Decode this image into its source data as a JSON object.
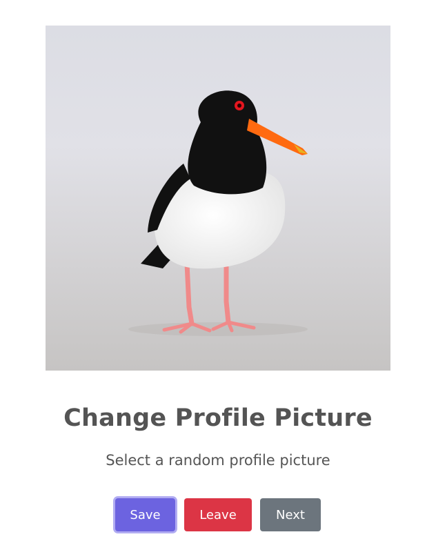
{
  "profile_picture": {
    "subject": "oystercatcher bird on sand",
    "colors": {
      "background_top": "#dcdde4",
      "background_bottom": "#c6c4c3",
      "feathers_dark": "#111111",
      "feathers_light": "#f7f7f7",
      "beak": "#ff6a10",
      "legs": "#f28c8c",
      "eye": "#e4161f"
    }
  },
  "heading": {
    "title": "Change Profile Picture",
    "subtitle": "Select a random profile picture"
  },
  "actions": {
    "save_label": "Save",
    "leave_label": "Leave",
    "next_label": "Next"
  },
  "theme": {
    "save_color": "#6c63e0",
    "leave_color": "#dc3545",
    "next_color": "#6c757d"
  }
}
